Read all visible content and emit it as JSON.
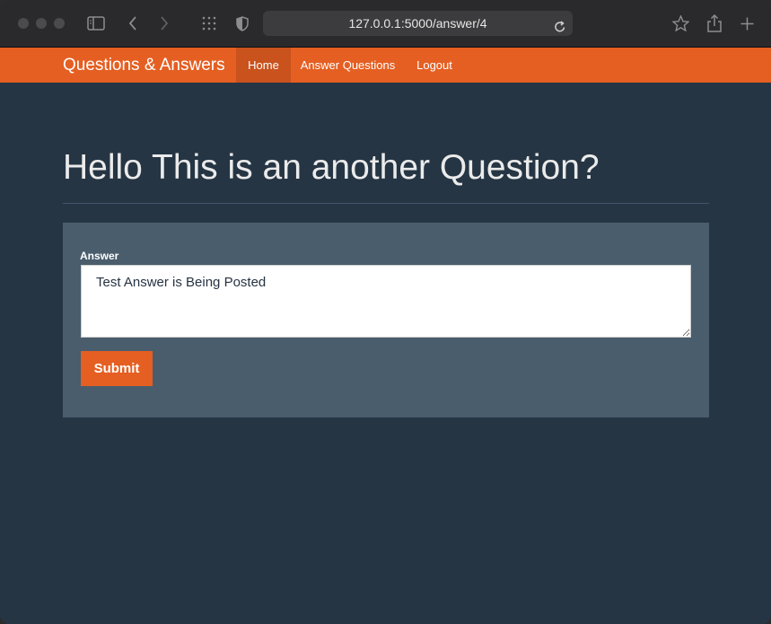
{
  "browser": {
    "url": "127.0.0.1:5000/answer/4"
  },
  "navbar": {
    "brand": "Questions & Answers",
    "items": [
      {
        "label": "Home",
        "active": true
      },
      {
        "label": "Answer Questions",
        "active": false
      },
      {
        "label": "Logout",
        "active": false
      }
    ]
  },
  "main": {
    "title": "Hello This is an another Question?",
    "form": {
      "answer_label": "Answer",
      "answer_value": "Test Answer is Being Posted",
      "submit_label": "Submit"
    }
  },
  "colors": {
    "accent": "#e55f22",
    "background": "#253544",
    "card": "#4a5d6c"
  }
}
